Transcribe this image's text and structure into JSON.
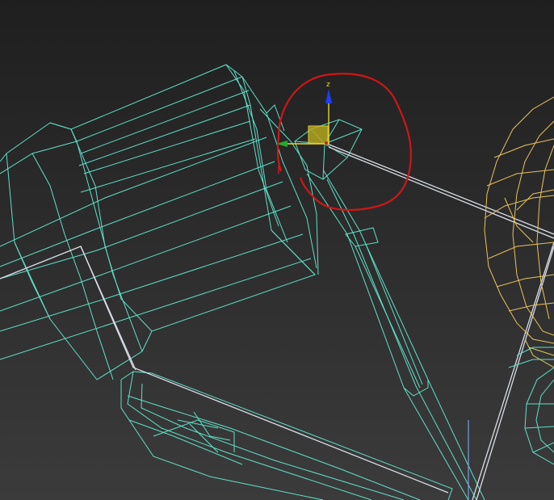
{
  "viewport": {
    "background_top": "#202020",
    "background_bottom": "#3a3a3a"
  },
  "colors": {
    "wire_cyan": "#5fe0c8",
    "wire_gold": "#e8c45a",
    "wire_white": "#d8dde6",
    "gizmo_z": "#1f3cff",
    "gizmo_x": "#d11b1b",
    "gizmo_y": "#1fae2c",
    "gizmo_plane": "#e5d62a",
    "annotation_circle": "#d01616"
  },
  "gizmo": {
    "z_label": "z"
  }
}
